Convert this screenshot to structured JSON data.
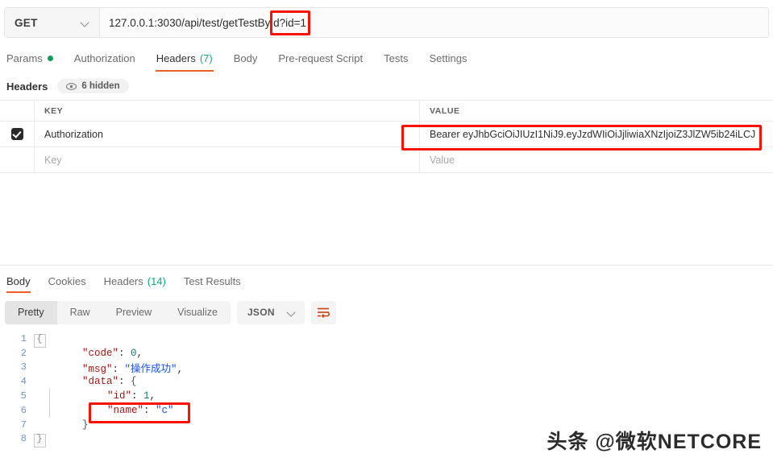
{
  "request": {
    "method": "GET",
    "url": "127.0.0.1:3030/api/test/getTestById?id=1",
    "tabs": [
      {
        "label": "Params",
        "has_dot": true,
        "active": false
      },
      {
        "label": "Authorization",
        "active": false
      },
      {
        "label": "Headers",
        "count": "(7)",
        "active": true
      },
      {
        "label": "Body",
        "active": false
      },
      {
        "label": "Pre-request Script",
        "active": false
      },
      {
        "label": "Tests",
        "active": false
      },
      {
        "label": "Settings",
        "active": false
      }
    ],
    "headers_section": {
      "title": "Headers",
      "hidden_badge": "6 hidden",
      "eye_icon": "eye-icon"
    },
    "table": {
      "columns": [
        "KEY",
        "VALUE"
      ],
      "rows": [
        {
          "checked": true,
          "key": "Authorization",
          "value": "Bearer eyJhbGciOiJIUzI1NiJ9.eyJzdWIiOiJjliwiaXNzIjoiZ3JlZW5ib24iLCJ"
        }
      ],
      "placeholder_row": {
        "key": "Key",
        "value": "Value"
      }
    }
  },
  "response": {
    "tabs": [
      {
        "label": "Body",
        "active": true
      },
      {
        "label": "Cookies",
        "active": false
      },
      {
        "label": "Headers",
        "count": "(14)",
        "active": false
      },
      {
        "label": "Test Results",
        "active": false
      }
    ],
    "format_bar": {
      "segments": [
        {
          "label": "Pretty",
          "active": true
        },
        {
          "label": "Raw",
          "active": false
        },
        {
          "label": "Preview",
          "active": false
        },
        {
          "label": "Visualize",
          "active": false
        }
      ],
      "language": "JSON",
      "chevron_icon": "chevron-down-icon",
      "wrap_icon": "word-wrap-icon"
    },
    "body_lines": [
      {
        "num": "1",
        "fold": "{",
        "boxed": true,
        "guide": false,
        "indent": 0,
        "tokens": []
      },
      {
        "num": "2",
        "fold": "",
        "boxed": false,
        "guide": false,
        "indent": 1,
        "tokens": [
          {
            "t": "\"code\"",
            "c": "k"
          },
          {
            "t": ": ",
            "c": "p"
          },
          {
            "t": "0",
            "c": "n"
          },
          {
            "t": ",",
            "c": "p"
          }
        ]
      },
      {
        "num": "3",
        "fold": "",
        "boxed": false,
        "guide": false,
        "indent": 1,
        "tokens": [
          {
            "t": "\"msg\"",
            "c": "k"
          },
          {
            "t": ": ",
            "c": "p"
          },
          {
            "t": "\"操作成功\"",
            "c": "s"
          },
          {
            "t": ",",
            "c": "p"
          }
        ]
      },
      {
        "num": "4",
        "fold": "",
        "boxed": false,
        "guide": false,
        "indent": 1,
        "tokens": [
          {
            "t": "\"data\"",
            "c": "k"
          },
          {
            "t": ": ",
            "c": "p"
          },
          {
            "t": "{",
            "c": "b"
          }
        ]
      },
      {
        "num": "5",
        "fold": "",
        "boxed": false,
        "guide": true,
        "indent": 2,
        "tokens": [
          {
            "t": "\"id\"",
            "c": "k"
          },
          {
            "t": ": ",
            "c": "p"
          },
          {
            "t": "1",
            "c": "n"
          },
          {
            "t": ",",
            "c": "p"
          }
        ]
      },
      {
        "num": "6",
        "fold": "",
        "boxed": false,
        "guide": true,
        "indent": 2,
        "tokens": [
          {
            "t": "\"name\"",
            "c": "k"
          },
          {
            "t": ": ",
            "c": "p"
          },
          {
            "t": "\"c\"",
            "c": "s"
          }
        ]
      },
      {
        "num": "7",
        "fold": "",
        "boxed": false,
        "guide": false,
        "indent": 1,
        "tokens": [
          {
            "t": "}",
            "c": "b"
          }
        ]
      },
      {
        "num": "8",
        "fold": "}",
        "boxed": true,
        "guide": false,
        "indent": 0,
        "tokens": []
      }
    ]
  },
  "watermark": "头条 @微软NETCORE",
  "colors": {
    "accent_orange": "#ef5b25",
    "count_green": "#0cac78",
    "dot_green": "#0f9d58",
    "annotation_red": "#fa1100",
    "json_key": "#a31515",
    "json_string": "#1b4ef5",
    "json_number": "#0f7a7a",
    "line_number": "#6e94c9"
  }
}
